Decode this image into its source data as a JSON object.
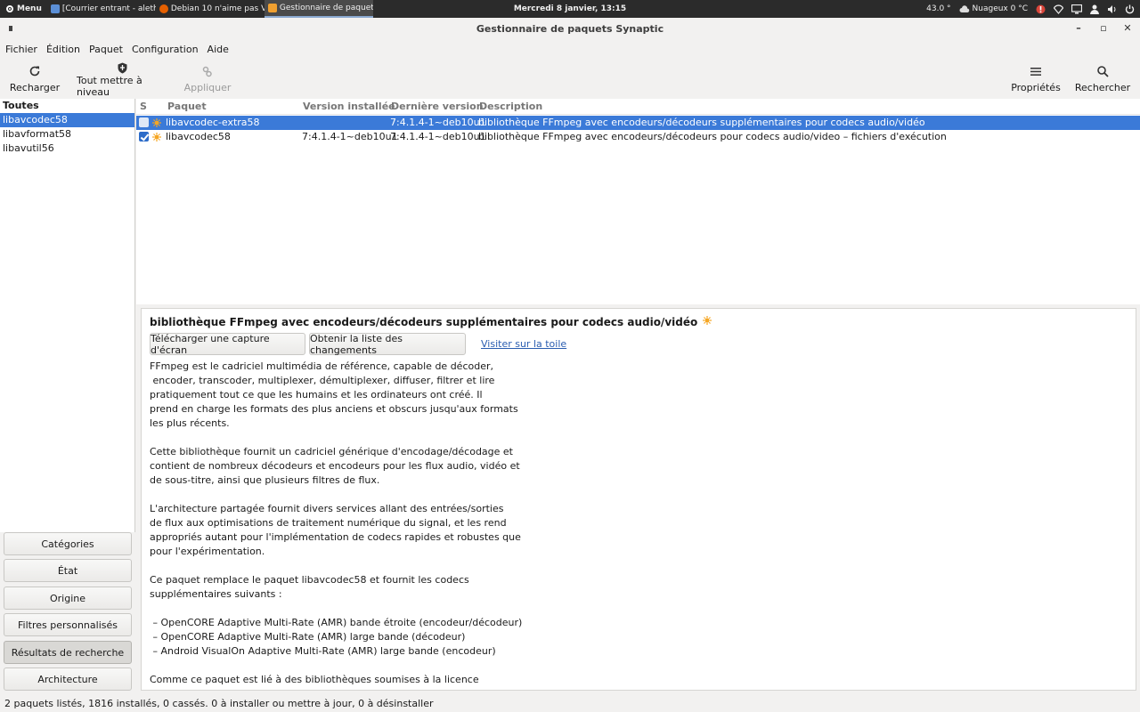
{
  "panel": {
    "menu_label": "Menu",
    "tasks": [
      {
        "label": "[Courrier entrant - aleth...",
        "icon": "mail-icon",
        "color": "#5b8fd6"
      },
      {
        "label": "Debian 10 n'aime pas V...",
        "icon": "firefox-icon",
        "color": "#e66000"
      },
      {
        "label": "Gestionnaire de paquet...",
        "icon": "synaptic-icon",
        "color": "#f0a030"
      }
    ],
    "clock": "Mercredi  8 janvier, 13:15",
    "temp": "43.0 °",
    "weather": "Nuageux 0 °C"
  },
  "window": {
    "title": "Gestionnaire de paquets Synaptic"
  },
  "menubar": [
    "Fichier",
    "Édition",
    "Paquet",
    "Configuration",
    "Aide"
  ],
  "toolbar": {
    "reload": "Recharger",
    "upgrade_all": "Tout mettre à niveau",
    "apply": "Appliquer",
    "properties": "Propriétés",
    "search": "Rechercher"
  },
  "sidebar": {
    "header": "Toutes",
    "items": [
      "libavcodec58",
      "libavformat58",
      "libavutil56"
    ],
    "selected_index": 0,
    "buttons": [
      "Catégories",
      "État",
      "Origine",
      "Filtres personnalisés",
      "Résultats de recherche",
      "Architecture"
    ],
    "pressed_index": 4
  },
  "pkglist": {
    "columns": {
      "s": "S",
      "package": "Paquet",
      "installed": "Version installée",
      "latest": "Dernière version",
      "description": "Description"
    },
    "rows": [
      {
        "name": "libavcodec-extra58",
        "installed": "",
        "latest": "7:4.1.4-1~deb10u1",
        "description": "bibliothèque FFmpeg avec encodeurs/décodeurs supplémentaires pour codecs audio/vidéo",
        "checked": false,
        "selected": true
      },
      {
        "name": "libavcodec58",
        "installed": "7:4.1.4-1~deb10u1",
        "latest": "7:4.1.4-1~deb10u1",
        "description": "bibliothèque FFmpeg avec encodeurs/décodeurs pour codecs audio/video – fichiers d'exécution",
        "checked": true,
        "selected": false
      }
    ]
  },
  "details": {
    "title": "bibliothèque FFmpeg avec encodeurs/décodeurs supplémentaires pour codecs audio/vidéo",
    "screenshot_button": "Télécharger une capture d'écran",
    "changelog_button": "Obtenir la liste des changements",
    "web_link": "Visiter sur la toile",
    "lines": [
      "FFmpeg est le cadriciel multimédia de référence, capable de décoder,",
      " encoder, transcoder, multiplexer, démultiplexer, diffuser, filtrer et lire",
      "pratiquement tout ce que les humains et les ordinateurs ont créé. Il",
      "prend en charge les formats des plus anciens et obscurs jusqu'aux formats",
      "les plus récents.",
      "",
      "Cette bibliothèque fournit un cadriciel générique d'encodage/décodage et",
      "contient de nombreux décodeurs et encodeurs pour les flux audio, vidéo et",
      "de sous-titre, ainsi que plusieurs filtres de flux.",
      "",
      "L'architecture partagée fournit divers services allant des entrées/sorties",
      "de flux aux optimisations de traitement numérique du signal, et les rend",
      "appropriés autant pour l'implémentation de codecs rapides et robustes que",
      "pour l'expérimentation.",
      "",
      "Ce paquet remplace le paquet libavcodec58 et fournit les codecs",
      "supplémentaires suivants :",
      "",
      " – OpenCORE Adaptive Multi-Rate (AMR) bande étroite (encodeur/décodeur)",
      " – OpenCORE Adaptive Multi-Rate (AMR) large bande (décodeur)",
      " – Android VisualOn Adaptive Multi-Rate (AMR) large bande (encodeur)",
      "",
      "Comme ce paquet est lié à des bibliothèques soumises à la licence"
    ]
  },
  "statusbar": "2 paquets listés, 1816 installés, 0 cassés. 0 à installer ou mettre à jour, 0 à désinstaller",
  "colors": {
    "selection": "#3b7ad8",
    "link": "#2a5db0",
    "badge": "#f5a623"
  }
}
